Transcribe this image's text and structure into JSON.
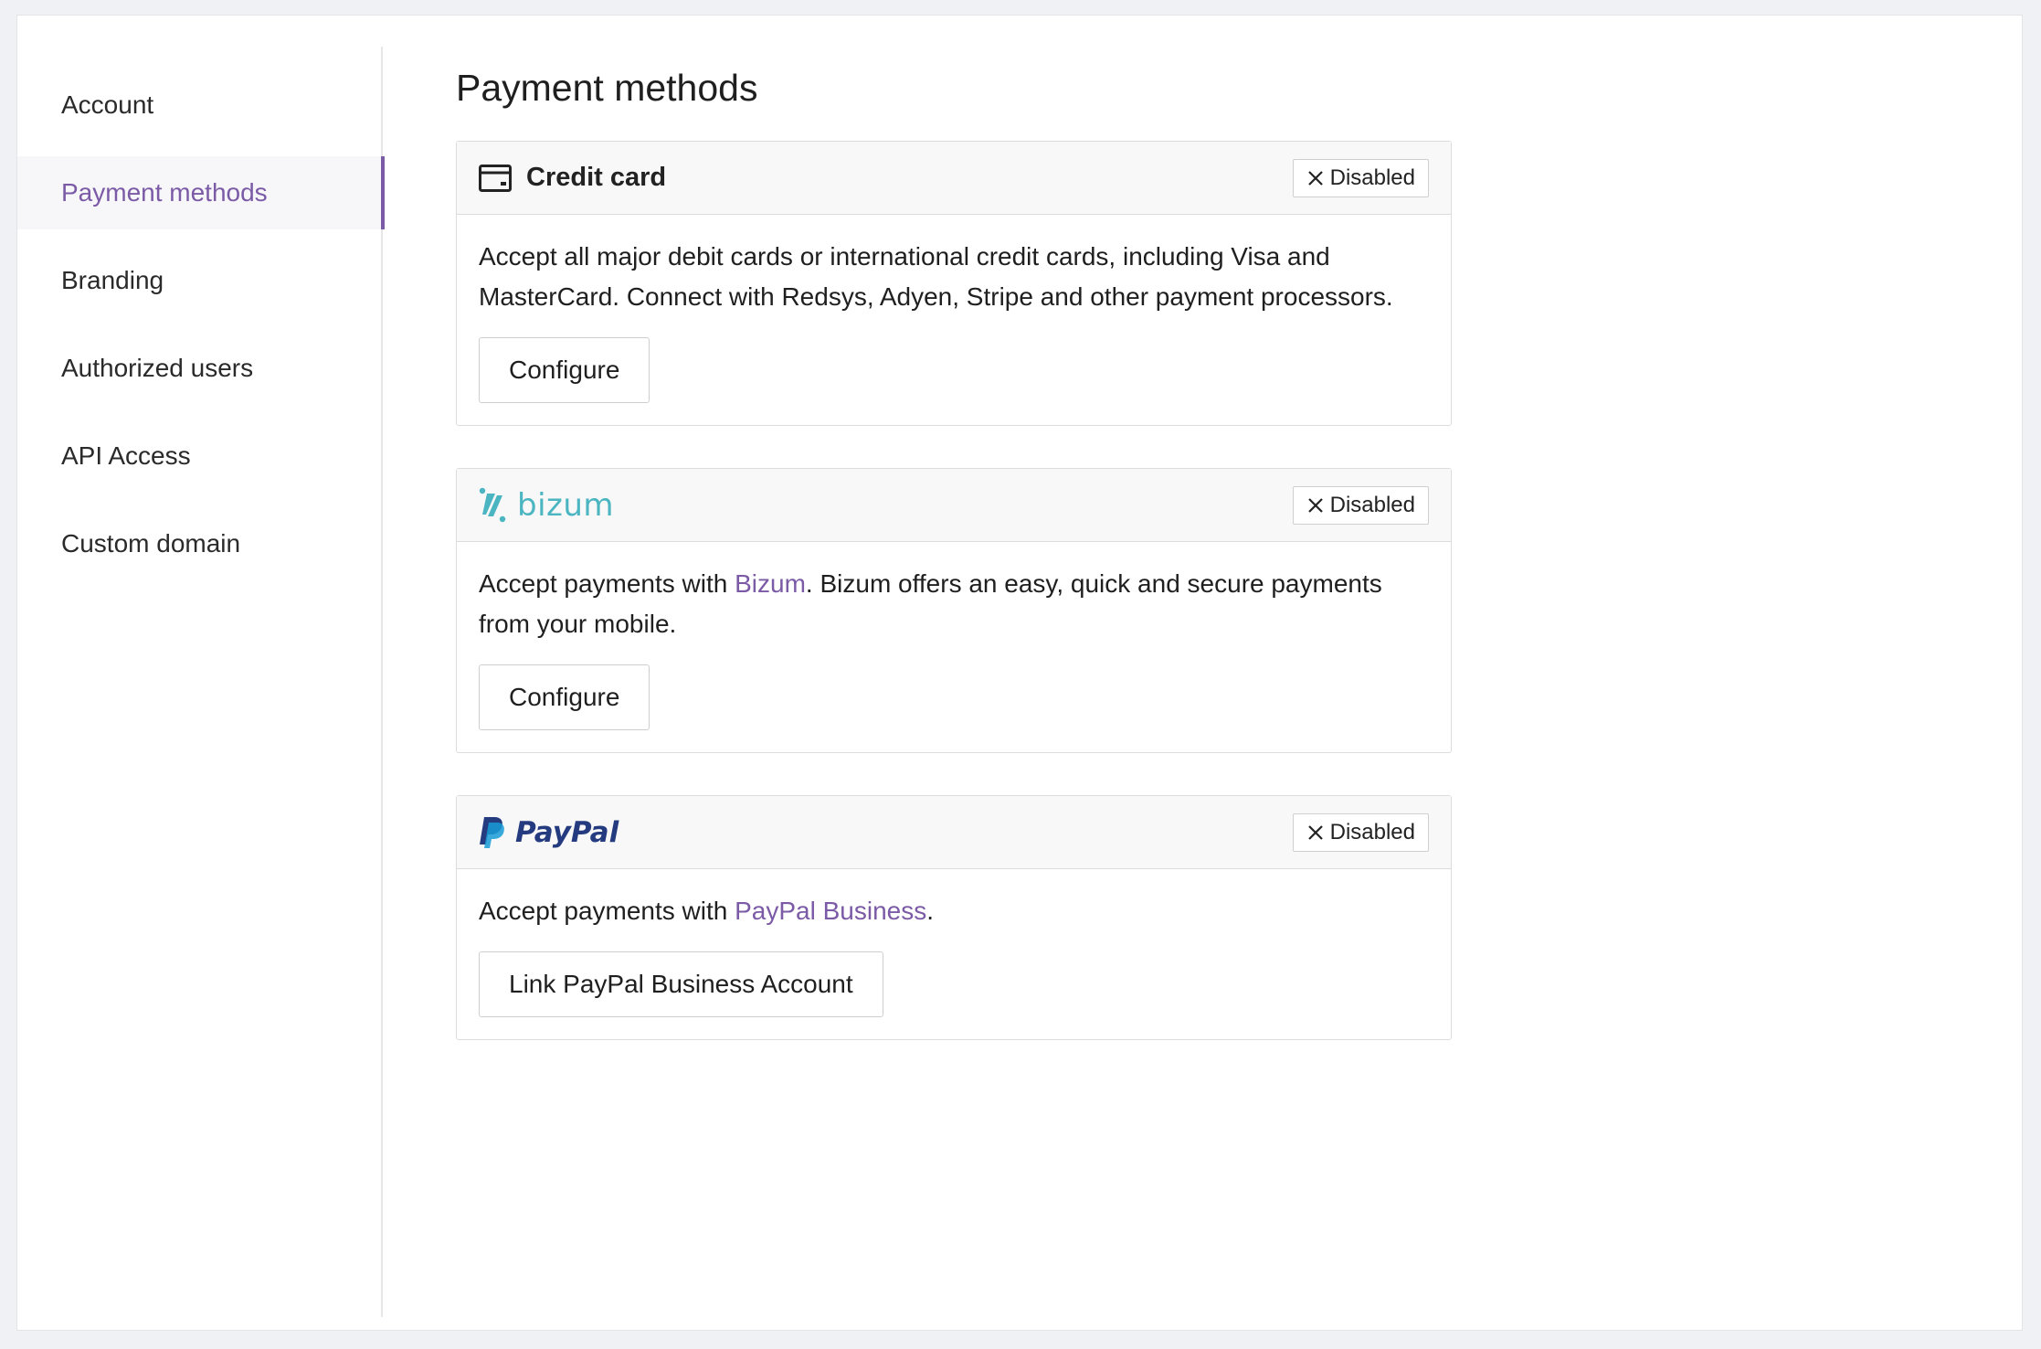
{
  "sidebar": {
    "items": [
      {
        "label": "Account"
      },
      {
        "label": "Payment methods",
        "active": true
      },
      {
        "label": "Branding"
      },
      {
        "label": "Authorized users"
      },
      {
        "label": "API Access"
      },
      {
        "label": "Custom domain"
      }
    ]
  },
  "main": {
    "title": "Payment methods",
    "cards": [
      {
        "title": "Credit card",
        "icon": "credit-card-icon",
        "status": "Disabled",
        "description": "Accept all major debit cards or international credit cards, including Visa and MasterCard. Connect with Redsys, Adyen, Stripe and other payment processors.",
        "button": "Configure"
      },
      {
        "logo": "bizum",
        "icon": "bizum-logo",
        "status": "Disabled",
        "description_prefix": "Accept payments with ",
        "link": "Bizum",
        "description_suffix": ". Bizum offers an easy, quick and secure payments from your mobile.",
        "button": "Configure"
      },
      {
        "logo": "PayPal",
        "icon": "paypal-logo",
        "status": "Disabled",
        "description_prefix": "Accept payments with ",
        "link": "PayPal Business",
        "description_suffix": ".",
        "button": "Link PayPal Business Account"
      }
    ]
  },
  "colors": {
    "accent": "#7b5aa6",
    "bizum": "#4bb5c1",
    "paypal_dark": "#253b80",
    "paypal_light": "#179bd7"
  }
}
